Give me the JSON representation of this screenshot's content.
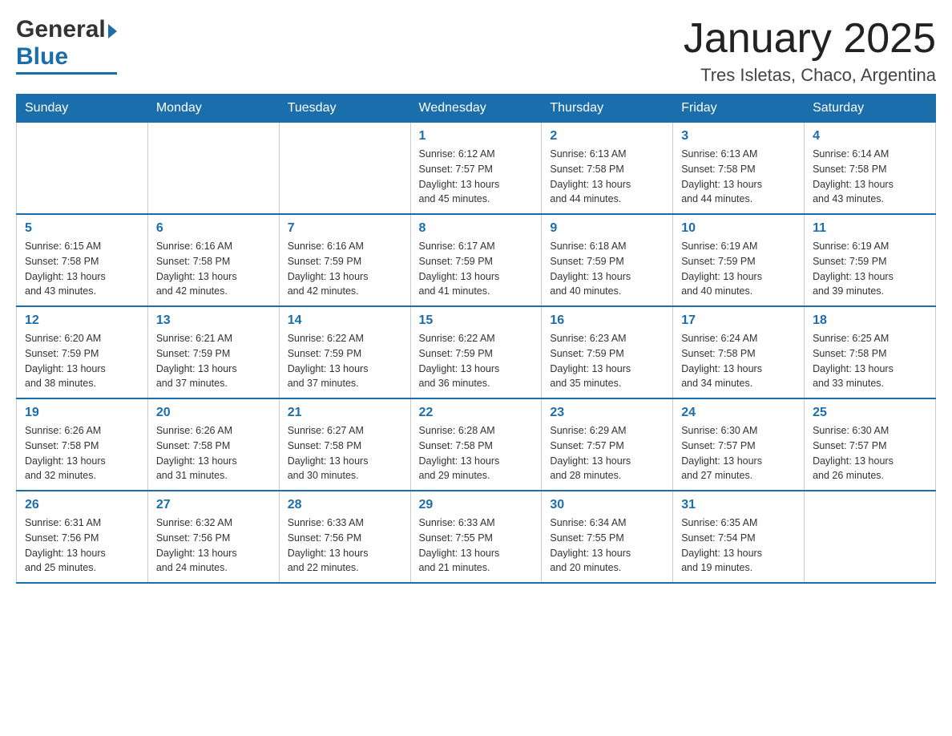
{
  "header": {
    "logo_general": "General",
    "logo_blue": "Blue",
    "month_title": "January 2025",
    "location": "Tres Isletas, Chaco, Argentina"
  },
  "weekdays": [
    "Sunday",
    "Monday",
    "Tuesday",
    "Wednesday",
    "Thursday",
    "Friday",
    "Saturday"
  ],
  "rows": [
    [
      {
        "day": "",
        "info": ""
      },
      {
        "day": "",
        "info": ""
      },
      {
        "day": "",
        "info": ""
      },
      {
        "day": "1",
        "info": "Sunrise: 6:12 AM\nSunset: 7:57 PM\nDaylight: 13 hours\nand 45 minutes."
      },
      {
        "day": "2",
        "info": "Sunrise: 6:13 AM\nSunset: 7:58 PM\nDaylight: 13 hours\nand 44 minutes."
      },
      {
        "day": "3",
        "info": "Sunrise: 6:13 AM\nSunset: 7:58 PM\nDaylight: 13 hours\nand 44 minutes."
      },
      {
        "day": "4",
        "info": "Sunrise: 6:14 AM\nSunset: 7:58 PM\nDaylight: 13 hours\nand 43 minutes."
      }
    ],
    [
      {
        "day": "5",
        "info": "Sunrise: 6:15 AM\nSunset: 7:58 PM\nDaylight: 13 hours\nand 43 minutes."
      },
      {
        "day": "6",
        "info": "Sunrise: 6:16 AM\nSunset: 7:58 PM\nDaylight: 13 hours\nand 42 minutes."
      },
      {
        "day": "7",
        "info": "Sunrise: 6:16 AM\nSunset: 7:59 PM\nDaylight: 13 hours\nand 42 minutes."
      },
      {
        "day": "8",
        "info": "Sunrise: 6:17 AM\nSunset: 7:59 PM\nDaylight: 13 hours\nand 41 minutes."
      },
      {
        "day": "9",
        "info": "Sunrise: 6:18 AM\nSunset: 7:59 PM\nDaylight: 13 hours\nand 40 minutes."
      },
      {
        "day": "10",
        "info": "Sunrise: 6:19 AM\nSunset: 7:59 PM\nDaylight: 13 hours\nand 40 minutes."
      },
      {
        "day": "11",
        "info": "Sunrise: 6:19 AM\nSunset: 7:59 PM\nDaylight: 13 hours\nand 39 minutes."
      }
    ],
    [
      {
        "day": "12",
        "info": "Sunrise: 6:20 AM\nSunset: 7:59 PM\nDaylight: 13 hours\nand 38 minutes."
      },
      {
        "day": "13",
        "info": "Sunrise: 6:21 AM\nSunset: 7:59 PM\nDaylight: 13 hours\nand 37 minutes."
      },
      {
        "day": "14",
        "info": "Sunrise: 6:22 AM\nSunset: 7:59 PM\nDaylight: 13 hours\nand 37 minutes."
      },
      {
        "day": "15",
        "info": "Sunrise: 6:22 AM\nSunset: 7:59 PM\nDaylight: 13 hours\nand 36 minutes."
      },
      {
        "day": "16",
        "info": "Sunrise: 6:23 AM\nSunset: 7:59 PM\nDaylight: 13 hours\nand 35 minutes."
      },
      {
        "day": "17",
        "info": "Sunrise: 6:24 AM\nSunset: 7:58 PM\nDaylight: 13 hours\nand 34 minutes."
      },
      {
        "day": "18",
        "info": "Sunrise: 6:25 AM\nSunset: 7:58 PM\nDaylight: 13 hours\nand 33 minutes."
      }
    ],
    [
      {
        "day": "19",
        "info": "Sunrise: 6:26 AM\nSunset: 7:58 PM\nDaylight: 13 hours\nand 32 minutes."
      },
      {
        "day": "20",
        "info": "Sunrise: 6:26 AM\nSunset: 7:58 PM\nDaylight: 13 hours\nand 31 minutes."
      },
      {
        "day": "21",
        "info": "Sunrise: 6:27 AM\nSunset: 7:58 PM\nDaylight: 13 hours\nand 30 minutes."
      },
      {
        "day": "22",
        "info": "Sunrise: 6:28 AM\nSunset: 7:58 PM\nDaylight: 13 hours\nand 29 minutes."
      },
      {
        "day": "23",
        "info": "Sunrise: 6:29 AM\nSunset: 7:57 PM\nDaylight: 13 hours\nand 28 minutes."
      },
      {
        "day": "24",
        "info": "Sunrise: 6:30 AM\nSunset: 7:57 PM\nDaylight: 13 hours\nand 27 minutes."
      },
      {
        "day": "25",
        "info": "Sunrise: 6:30 AM\nSunset: 7:57 PM\nDaylight: 13 hours\nand 26 minutes."
      }
    ],
    [
      {
        "day": "26",
        "info": "Sunrise: 6:31 AM\nSunset: 7:56 PM\nDaylight: 13 hours\nand 25 minutes."
      },
      {
        "day": "27",
        "info": "Sunrise: 6:32 AM\nSunset: 7:56 PM\nDaylight: 13 hours\nand 24 minutes."
      },
      {
        "day": "28",
        "info": "Sunrise: 6:33 AM\nSunset: 7:56 PM\nDaylight: 13 hours\nand 22 minutes."
      },
      {
        "day": "29",
        "info": "Sunrise: 6:33 AM\nSunset: 7:55 PM\nDaylight: 13 hours\nand 21 minutes."
      },
      {
        "day": "30",
        "info": "Sunrise: 6:34 AM\nSunset: 7:55 PM\nDaylight: 13 hours\nand 20 minutes."
      },
      {
        "day": "31",
        "info": "Sunrise: 6:35 AM\nSunset: 7:54 PM\nDaylight: 13 hours\nand 19 minutes."
      },
      {
        "day": "",
        "info": ""
      }
    ]
  ]
}
